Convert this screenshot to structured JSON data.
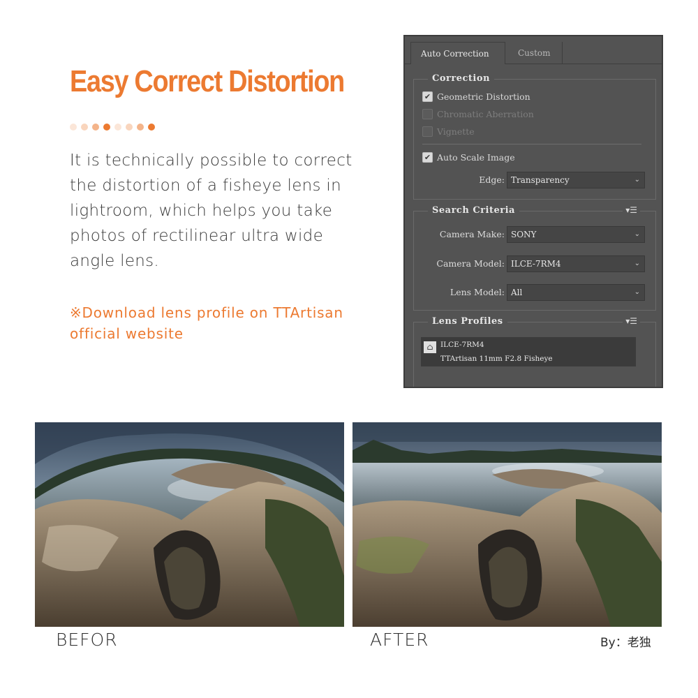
{
  "headline": "Easy Correct Distortion",
  "dots": [
    "#fbe6d8",
    "#f9d5bd",
    "#f4b48a",
    "#ec7a31",
    "#fbe6d8",
    "#f9d5bd",
    "#f4b48a",
    "#ec7a31"
  ],
  "body": "It is technically possible to correct the distortion of a fisheye lens in lightroom, which helps you take photos of rectilinear ultra wide angle lens.",
  "note": "※Download lens profile on TTArtisan official website",
  "accent_color": "#ec7a31",
  "panel": {
    "tabs": [
      {
        "label": "Auto Correction",
        "active": true
      },
      {
        "label": "Custom",
        "active": false
      }
    ],
    "correction": {
      "title": "Correction",
      "geometric_distortion": {
        "label": "Geometric Distortion",
        "checked": true
      },
      "chromatic_aberration": {
        "label": "Chromatic Aberration",
        "checked": false
      },
      "vignette": {
        "label": "Vignette",
        "checked": false
      },
      "auto_scale": {
        "label": "Auto Scale Image",
        "checked": true
      },
      "edge_label": "Edge:",
      "edge_value": "Transparency"
    },
    "search": {
      "title": "Search Criteria",
      "camera_make_label": "Camera Make:",
      "camera_make_value": "SONY",
      "camera_model_label": "Camera Model:",
      "camera_model_value": "ILCE-7RM4",
      "lens_model_label": "Lens Model:",
      "lens_model_value": "All"
    },
    "profiles": {
      "title": "Lens Profiles",
      "item_line1": "ILCE-7RM4",
      "item_line2": "TTArtisan 11mm F2.8 Fisheye"
    }
  },
  "captions": {
    "before": "BEFOR",
    "after": "AFTER",
    "credit": "By：老独"
  }
}
